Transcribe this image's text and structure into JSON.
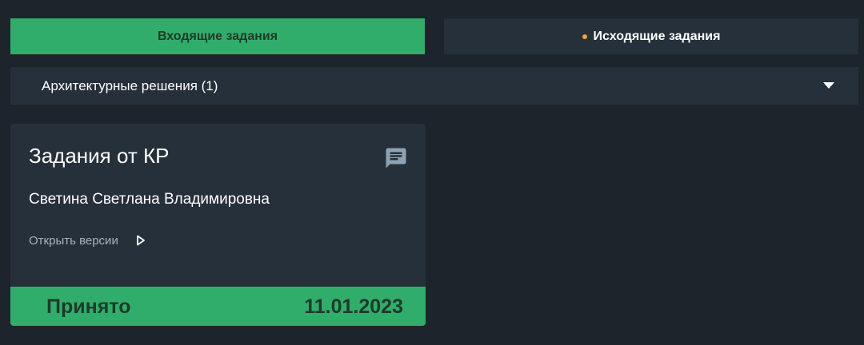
{
  "tabs": {
    "incoming_label": "Входящие задания",
    "outgoing_label": "Исходящие задания"
  },
  "section": {
    "title": "Архитектурные решения (1)"
  },
  "card": {
    "title": "Задания от КР",
    "person": "Светина Светлана Владимировна",
    "versions_label": "Открыть версии",
    "status": "Принято",
    "date": "11.01.2023",
    "icons": [
      "chat-icon",
      "play-icon"
    ]
  },
  "colors": {
    "background": "#1d242b",
    "panel": "#26303a",
    "accent_green": "#31ad6b",
    "notification_dot": "#f2a23a"
  }
}
